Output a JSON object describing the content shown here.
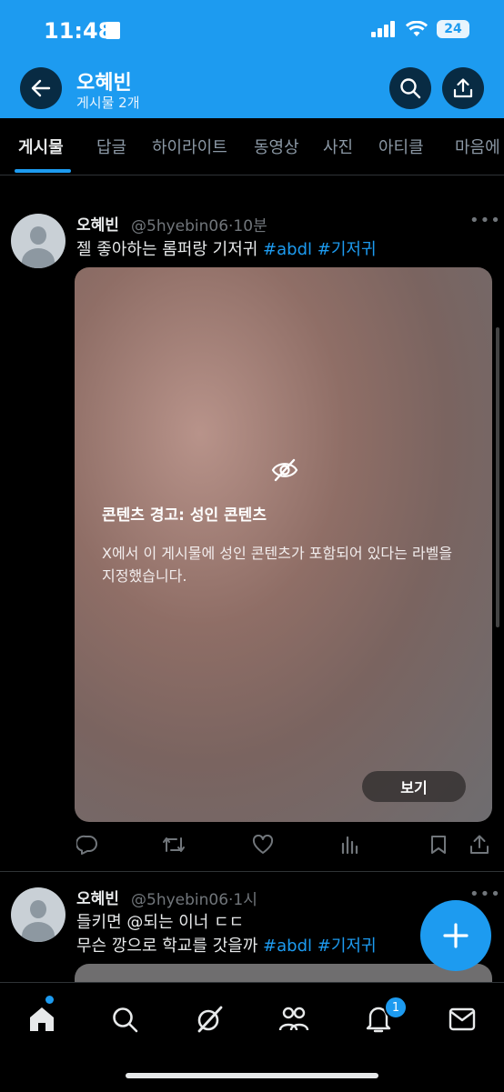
{
  "status_bar": {
    "time": "11:48",
    "battery": "24"
  },
  "header": {
    "title": "오혜빈",
    "subtitle": "게시물 2개"
  },
  "tabs": [
    "게시물",
    "답글",
    "하이라이트",
    "동영상",
    "사진",
    "아티클",
    "마음에"
  ],
  "posts": [
    {
      "name": "오혜빈",
      "handle": "@5hyebin06",
      "time": "·10분",
      "text": "젤 좋아하는 롬퍼랑 기저귀 ",
      "tags": [
        "#abdl",
        "#기저귀"
      ],
      "warning_title": "콘텐츠 경고: 성인 콘텐츠",
      "warning_body": "X에서 이 게시물에 성인 콘텐츠가 포함되어 있다는 라벨을 지정했습니다.",
      "view_button": "보기"
    },
    {
      "name": "오혜빈",
      "handle": "@5hyebin06",
      "time": "·1시",
      "line1": "들키면 @되는 이너 ㄷㄷ",
      "line2": "무슨 깡으로 학교를 갓을까 ",
      "tags": [
        "#abdl",
        "#기저귀"
      ]
    }
  ],
  "bottom_nav": {
    "notifications_badge": "1"
  },
  "icons": [
    "back-arrow-icon",
    "search-icon",
    "share-icon",
    "eye-off-icon",
    "reply-icon",
    "retweet-icon",
    "like-icon",
    "views-icon",
    "bookmark-icon",
    "plus-icon",
    "home-icon",
    "grok-icon",
    "communities-icon",
    "bell-icon",
    "mail-icon"
  ],
  "colors": {
    "accent": "#1d9bf0",
    "background": "#000000"
  }
}
